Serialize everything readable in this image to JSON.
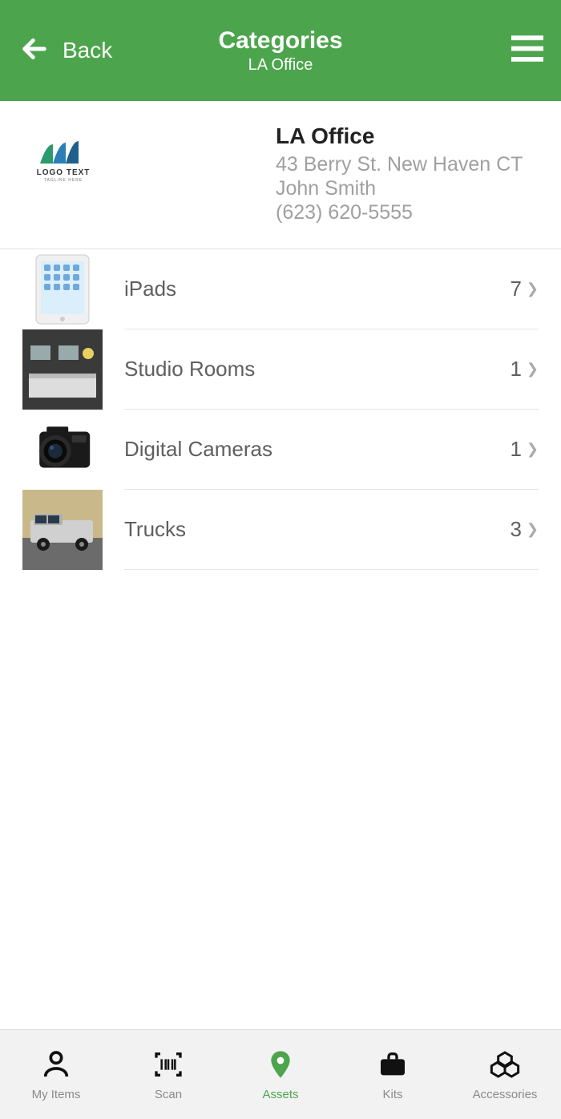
{
  "header": {
    "back_label": "Back",
    "title": "Categories",
    "subtitle": "LA Office"
  },
  "location": {
    "name": "LA Office",
    "address": "43 Berry St. New Haven CT",
    "contact": "John Smith",
    "phone": "(623) 620-5555",
    "logo_text1": "LOGO TEXT",
    "logo_text2": "TAGLINE HERE"
  },
  "categories": [
    {
      "label": "iPads",
      "count": "7"
    },
    {
      "label": "Studio Rooms",
      "count": "1"
    },
    {
      "label": "Digital Cameras",
      "count": "1"
    },
    {
      "label": "Trucks",
      "count": "3"
    }
  ],
  "tabs": [
    {
      "label": "My Items"
    },
    {
      "label": "Scan"
    },
    {
      "label": "Assets"
    },
    {
      "label": "Kits"
    },
    {
      "label": "Accessories"
    }
  ],
  "colors": {
    "accent": "#4ca54c"
  }
}
